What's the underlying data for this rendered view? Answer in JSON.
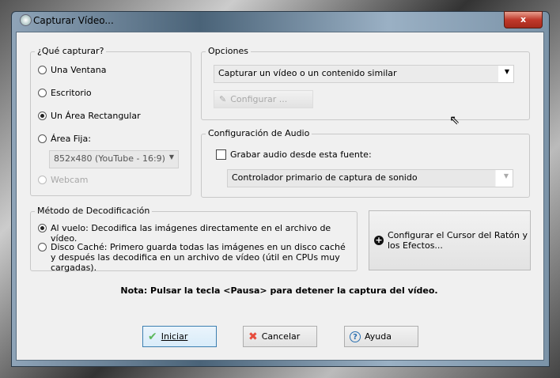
{
  "window": {
    "title": "Capturar Vídeo...",
    "close": "x"
  },
  "what": {
    "legend": "¿Qué capturar?",
    "options": [
      "Una Ventana",
      "Escritorio",
      "Un Área Rectangular",
      "Área Fija:"
    ],
    "selected": 2,
    "fixed_size": "852x480 (YouTube - 16:9)",
    "webcam": "Webcam"
  },
  "options": {
    "legend": "Opciones",
    "mode": "Capturar un vídeo o un contenido similar",
    "configure": "Configurar ..."
  },
  "audio": {
    "legend": "Configuración de Audio",
    "record_label": "Grabar audio desde esta fuente:",
    "record_checked": false,
    "source": "Controlador primario de captura de sonido"
  },
  "decode": {
    "legend": "Método de Decodificación",
    "on_the_fly": "Al vuelo: Decodifica las imágenes directamente en el archivo de vídeo.",
    "disk_cache": "Disco Caché: Primero guarda todas las imágenes en un disco caché y después las decodifica en un archivo de vídeo (útil en CPUs muy cargadas).",
    "selected": "on_the_fly"
  },
  "cursor_button": "Configurar el Cursor del Ratón y los Efectos...",
  "note": "Nota: Pulsar la tecla <Pausa> para detener la captura del vídeo.",
  "buttons": {
    "start": "Iniciar",
    "cancel": "Cancelar",
    "help": "Ayuda"
  }
}
